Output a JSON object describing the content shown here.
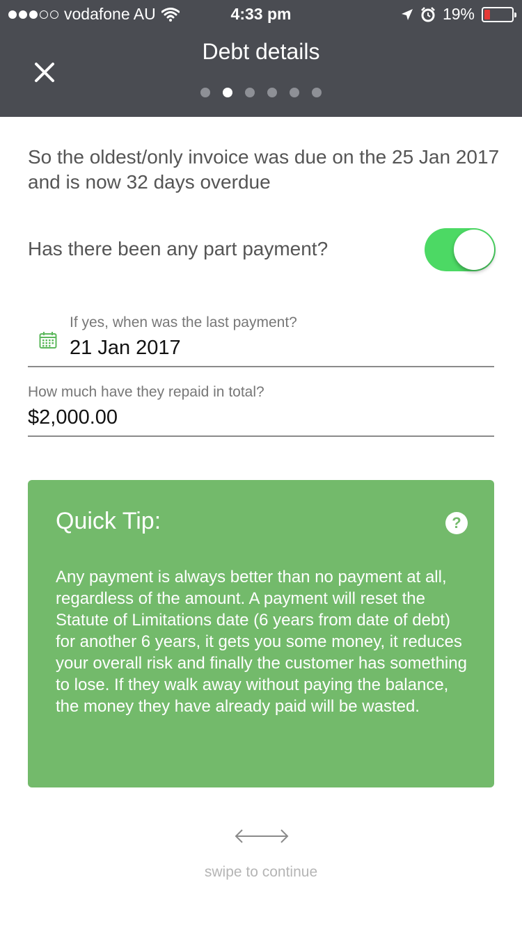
{
  "status_bar": {
    "carrier": "vodafone AU",
    "time": "4:33 pm",
    "battery": "19%",
    "battery_level": 0.19,
    "icons": [
      "wifi-icon",
      "location-arrow-icon",
      "alarm-icon",
      "battery-icon"
    ]
  },
  "header": {
    "title": "Debt details",
    "close_icon": "close-icon",
    "pager": {
      "total": 6,
      "active_index": 1
    }
  },
  "summary": "So the oldest/only invoice was due on the 25 Jan 2017 and is now 32 days overdue",
  "part_payment": {
    "question": "Has there been any part payment?",
    "toggle_on": true,
    "toggle_color": "#4cd964"
  },
  "last_payment": {
    "label": "If yes, when was the last payment?",
    "value": "21 Jan 2017",
    "icon": "calendar-icon"
  },
  "repaid_total": {
    "label": "How much have they repaid in total?",
    "value": "$2,000.00"
  },
  "tip": {
    "title": "Quick Tip:",
    "body": "Any payment is always better than no payment at all, regardless of the amount. A payment will reset the Statute of Limitations date (6 years from date of debt) for another 6 years, it gets you some money, it reduces your overall risk and finally the customer has something to lose. If they walk away without paying the balance, the money they have already paid will be wasted.",
    "help_icon": "?",
    "background": "#73ba6b"
  },
  "footer": {
    "swipe_text": "swipe to continue",
    "icon": "swipe-arrow-icon"
  }
}
